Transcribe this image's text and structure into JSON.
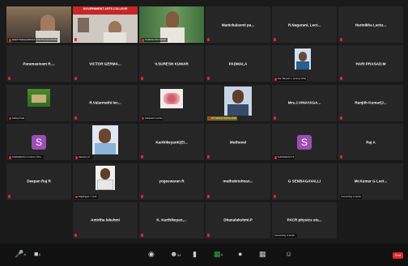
{
  "colors": {
    "background": "#1a1a1a",
    "tile": "#262626",
    "muted": "#e02828",
    "avatar": "#9b4fb5"
  },
  "participants": [
    {
      "name": "",
      "caption": "DEEP PEDHAVARDHI ANANTHASAYANAM"
    },
    {
      "name": "",
      "caption": "",
      "banner": "GOVERNMENT ARTS COLLEGE"
    },
    {
      "name": "",
      "caption": "SURESH PETHAVAL"
    },
    {
      "name": "Manickalaxmi pa..."
    },
    {
      "name": "R.Nagarani, Lect..."
    },
    {
      "name": "Harinikha Lectu..."
    },
    {
      "name": "Paramasivam R...."
    },
    {
      "name": "VICTOR GERMA..."
    },
    {
      "name": "V.SURESH KUMAR"
    },
    {
      "name": "PADMALA"
    },
    {
      "name": "",
      "caption": "Kat. Banesh L. lecturer (Phi)"
    },
    {
      "name": "HARI PRASAD.M"
    },
    {
      "name": "",
      "caption": "Sathya Kala"
    },
    {
      "name": "R.Valarmathi lec..."
    },
    {
      "name": "",
      "caption": "Kalaiselvi Lecthic"
    },
    {
      "name": "",
      "caption": "GT GETHA NATALLONE"
    },
    {
      "name": "Mrs.J.VINAYAGA..."
    },
    {
      "name": "Ranjith Kumar(J..."
    },
    {
      "name": "",
      "avatar": "S",
      "caption": "Subbalakshmi Lecturer (Che..."
    },
    {
      "name": "",
      "caption": "Saravan (C..."
    },
    {
      "name": "KarthikeyanK(El..."
    },
    {
      "name": "Muthuvel"
    },
    {
      "name": "",
      "avatar": "S",
      "caption": "Subhalakshmi S"
    },
    {
      "name": "Raj A"
    },
    {
      "name": "Deepan Raj R"
    },
    {
      "name": "",
      "caption": "Rajalingam L Gok."
    },
    {
      "name": "yogeswaran R"
    },
    {
      "name": "muthukrishnan..."
    },
    {
      "name": "G SENBAGAVALLI"
    },
    {
      "name": "Mr.Kumar G Lect...",
      "caption": "Connecting to audio"
    },
    {
      "name": "Amirtha lakshmi"
    },
    {
      "name": "K. Karthikeyan,..."
    },
    {
      "name": "Dhanalakshmi.P"
    },
    {
      "name": "PACR physics sta...",
      "caption": "Connecting to audio..."
    }
  ],
  "toolbar": {
    "participants_count": "54",
    "end_label": "End"
  }
}
